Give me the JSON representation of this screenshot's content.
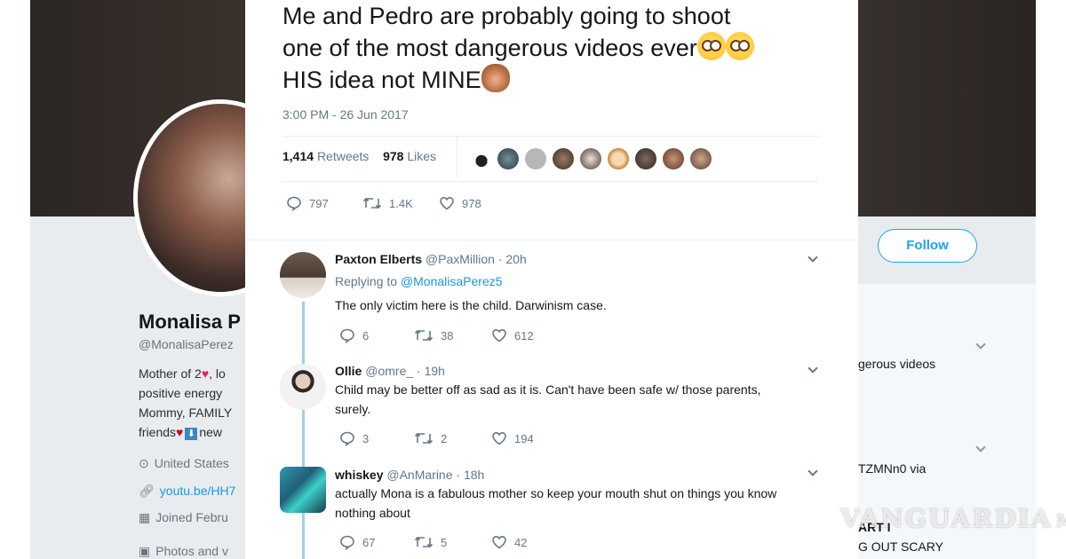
{
  "tweet": {
    "line1": "Me and Pedro are probably going to shoot",
    "line2": "one of the most dangerous videos ever",
    "line3": "HIS idea not MINE",
    "timestamp": "3:00 PM - 26 Jun 2017",
    "retweet_count": "1,414",
    "retweet_label": "Retweets",
    "like_count": "978",
    "like_label": "Likes",
    "actions": {
      "replies": "797",
      "retweets": "1.4K",
      "likes": "978"
    }
  },
  "replies": [
    {
      "name": "Paxton Elberts",
      "handle": "@PaxMillion",
      "time": "20h",
      "replying_label": "Replying to",
      "replying_to": "@MonalisaPerez5",
      "text": "The only victim here is the child. Darwinism case.",
      "replies": "6",
      "retweets": "38",
      "likes": "612"
    },
    {
      "name": "Ollie",
      "handle": "@omre_",
      "time": "19h",
      "text_line1": "Child may be better off as sad as it is. Can't have been safe w/ those parents,",
      "text_line2": "surely.",
      "replies": "3",
      "retweets": "2",
      "likes": "194"
    },
    {
      "name": "whiskey",
      "handle": "@AnMarine",
      "time": "18h",
      "text_line1": "actually Mona is a fabulous mother so keep your mouth shut on things you know",
      "text_line2": "nothing about",
      "replies": "67",
      "retweets": "5",
      "likes": "42"
    }
  ],
  "background_profile": {
    "name": "Monalisa P",
    "handle": "@MonalisaPerez",
    "bio_line1": "Mother of 2",
    "bio_line1_tail": ", lo",
    "bio_line2": "positive energy",
    "bio_line3": "Mommy, FAMILY",
    "bio_line4": "friends",
    "bio_line4_tail": "new",
    "location": "United States",
    "link": "youtu.be/HH7",
    "joined": "Joined Febru",
    "photos": "Photos and v",
    "follow_label": "Follow",
    "right_text_1": "gerous videos",
    "right_text_2": "TZMNn0 via",
    "right_text_3": "ART I",
    "right_text_4": "G OUT SCARY"
  },
  "watermark": "VANGUARDIA",
  "watermark_tail": "MX",
  "colors": {
    "link": "#1b95e0",
    "follow": "#1da1f2",
    "thread_line": "#9bd2e8",
    "heart": "#e0245e"
  }
}
